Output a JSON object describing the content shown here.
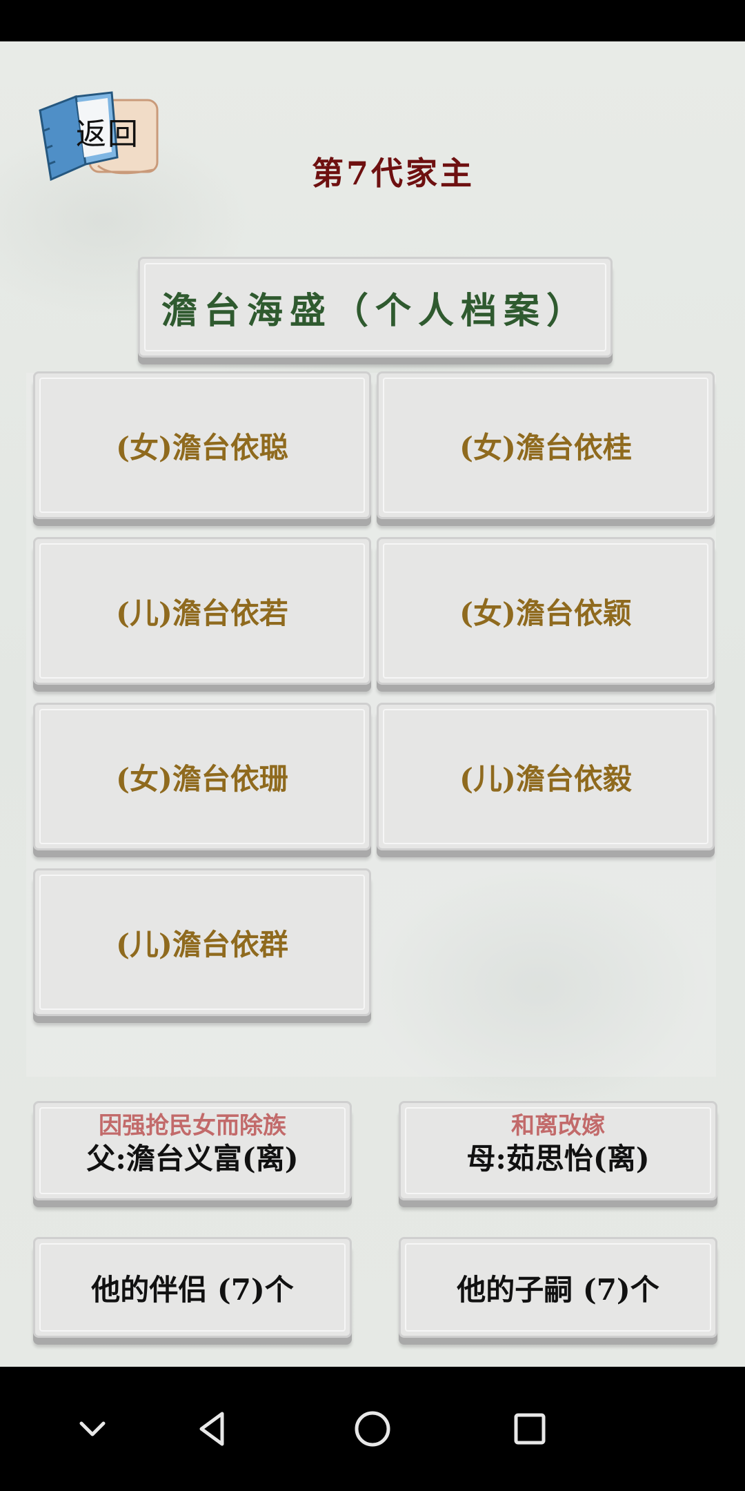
{
  "header": {
    "back_label": "返回",
    "generation_title": "第7代家主",
    "profile_title": "澹台海盛（个人档案）"
  },
  "children": [
    {
      "label": "(女)澹台依聪"
    },
    {
      "label": "(女)澹台依桂"
    },
    {
      "label": "(儿)澹台依若"
    },
    {
      "label": "(女)澹台依颖"
    },
    {
      "label": "(女)澹台依珊"
    },
    {
      "label": "(儿)澹台依毅"
    },
    {
      "label": "(儿)澹台依群"
    }
  ],
  "parents": {
    "father": {
      "note": "因强抢民女而除族",
      "label": "父:澹台义富(离)"
    },
    "mother": {
      "note": "和离改嫁",
      "label": "母:茹思怡(离)"
    }
  },
  "summary": {
    "partners_label": "他的伴侣 (7)个",
    "heirs_label": "他的子嗣 (7)个"
  },
  "icons": {
    "back": "book-icon",
    "nav_hide": "chevron-down-icon",
    "nav_back": "triangle-back-icon",
    "nav_home": "circle-home-icon",
    "nav_recent": "square-recent-icon"
  },
  "colors": {
    "generation_title": "#6e1010",
    "profile_title": "#2f5a2f",
    "child_label": "#8f6a1e",
    "parent_note": "#c26a6a"
  }
}
